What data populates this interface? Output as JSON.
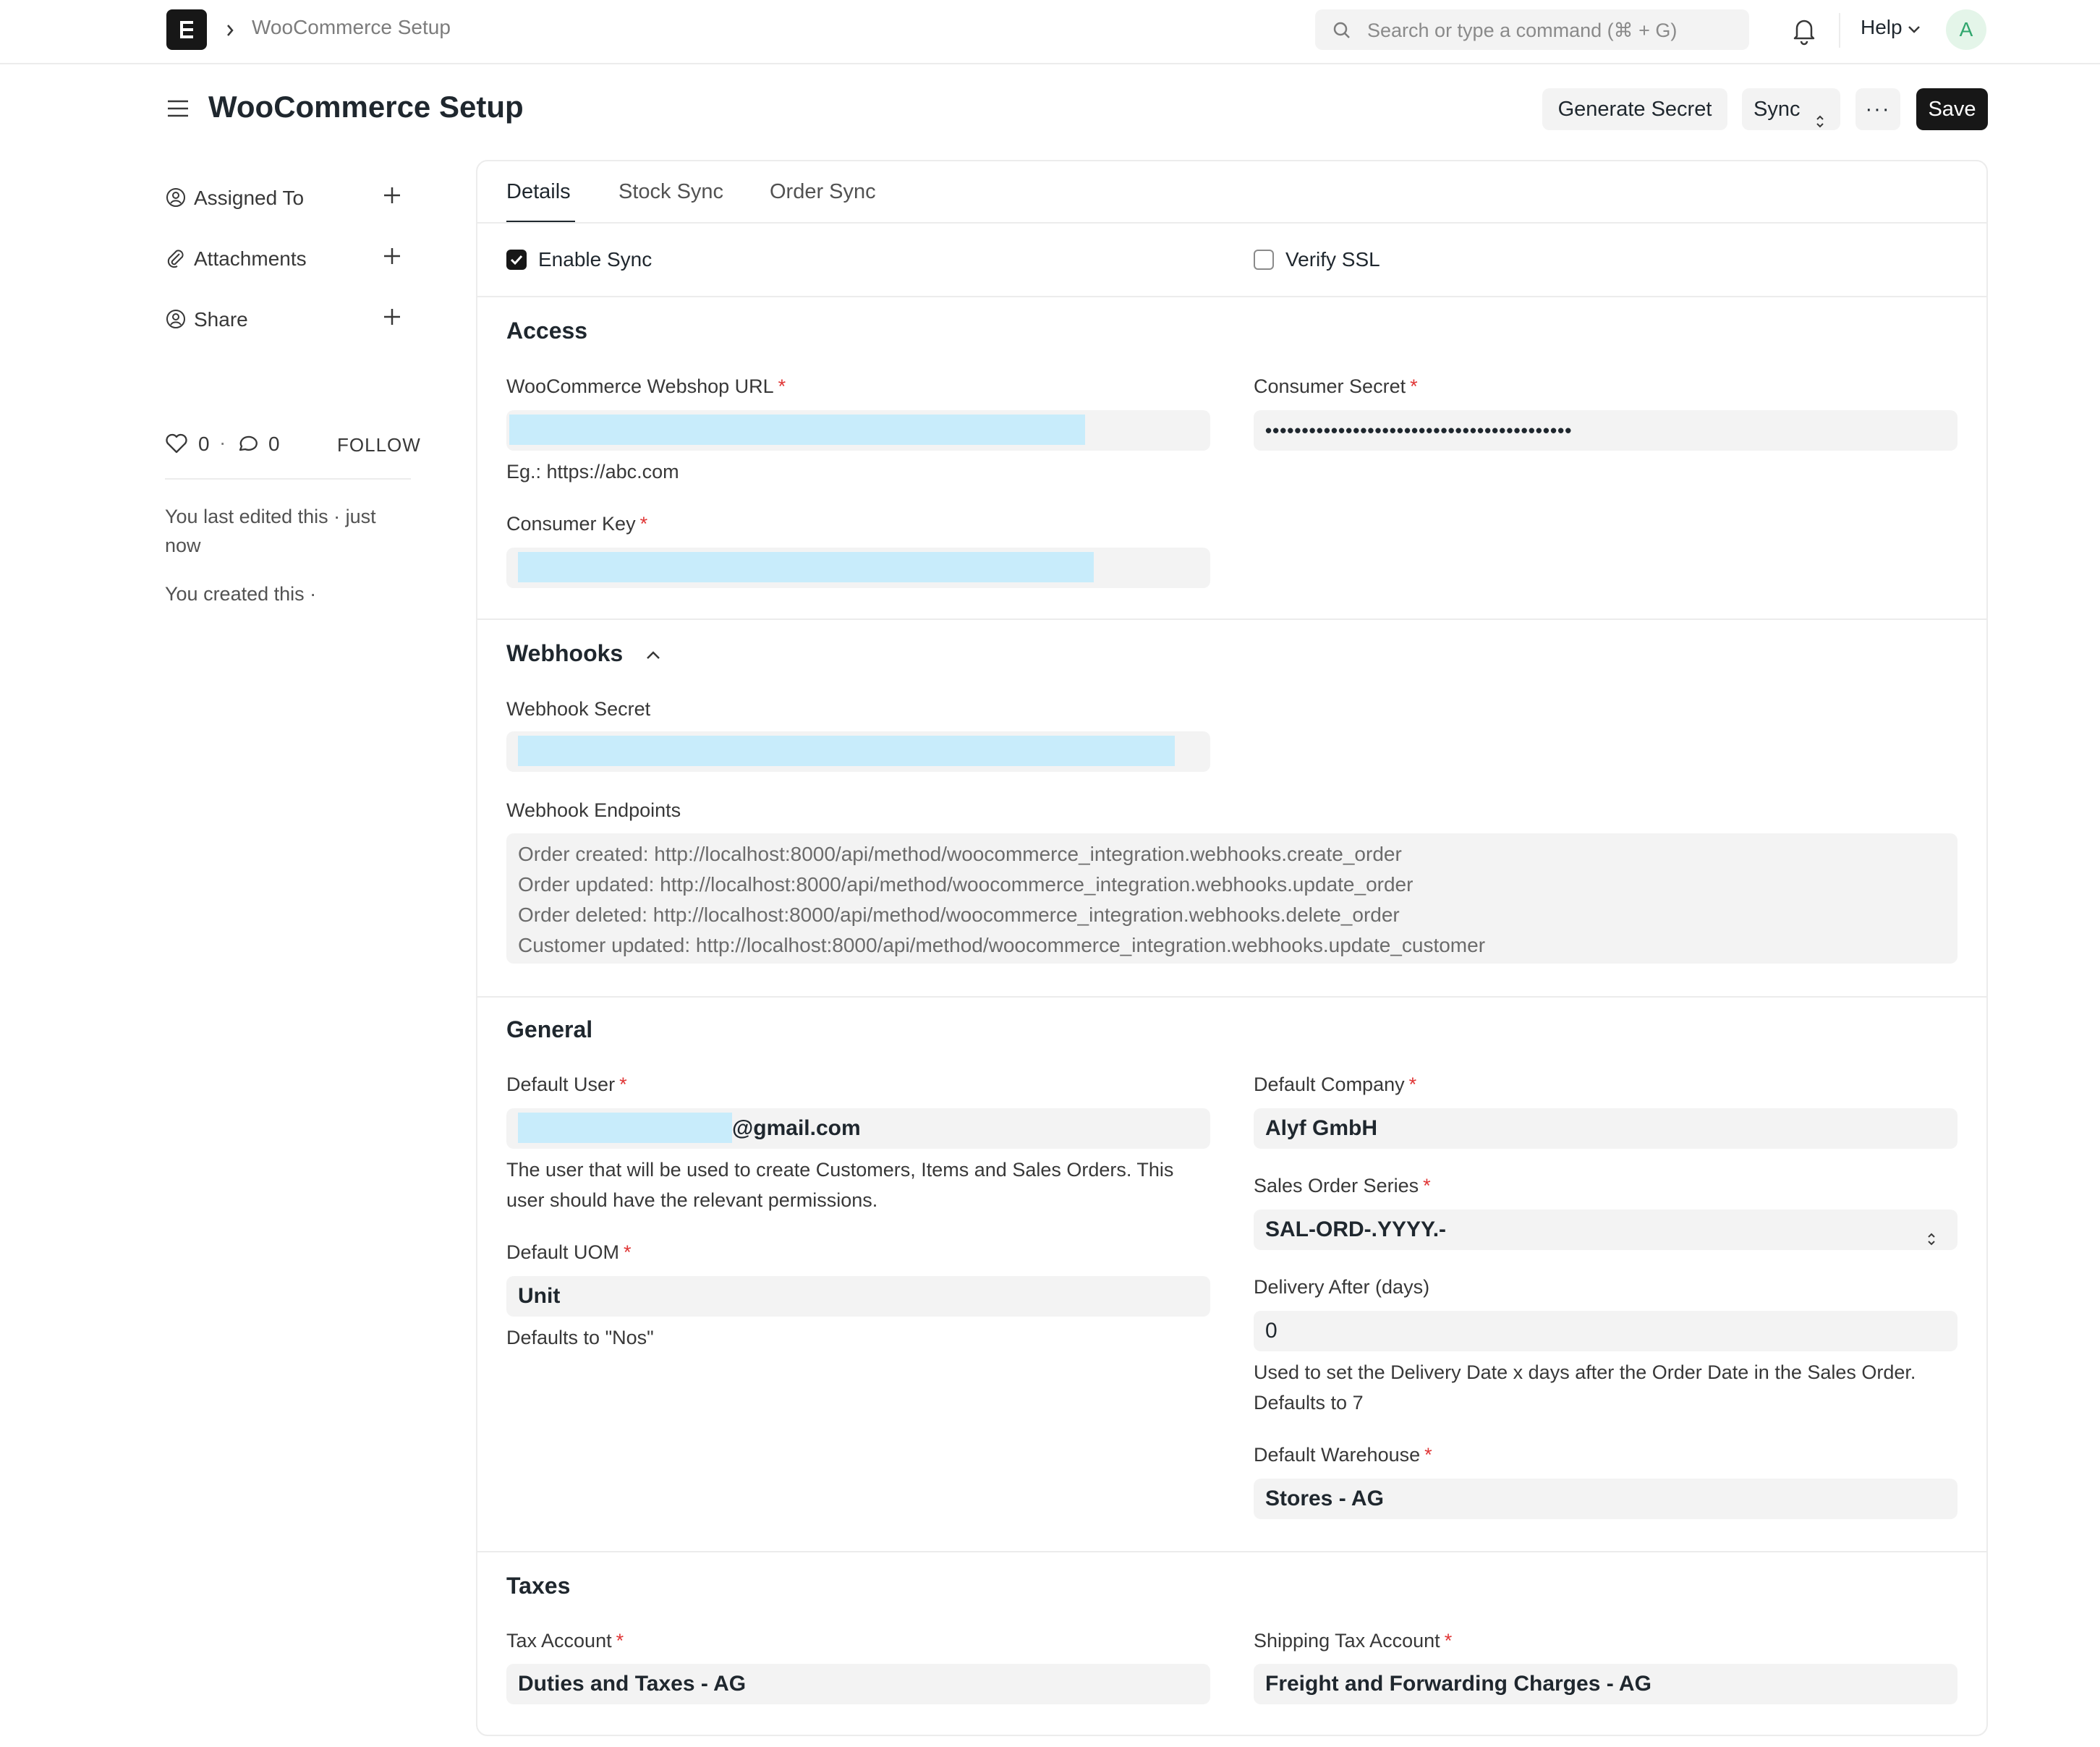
{
  "navbar": {
    "breadcrumb": "WooCommerce Setup",
    "search_placeholder": "Search or type a command (⌘ + G)",
    "help_label": "Help",
    "avatar_initial": "A"
  },
  "page": {
    "title": "WooCommerce Setup",
    "actions": {
      "generate_secret": "Generate Secret",
      "sync": "Sync",
      "more": "···",
      "save": "Save"
    }
  },
  "sidebar": {
    "items": [
      {
        "label": "Assigned To",
        "icon": "assign-icon"
      },
      {
        "label": "Attachments",
        "icon": "paperclip-icon"
      },
      {
        "label": "Share",
        "icon": "share-icon"
      }
    ],
    "likes": "0",
    "comments": "0",
    "follow": "FOLLOW",
    "activity": [
      "You last edited this · just now",
      "You created this ·"
    ]
  },
  "tabs": [
    "Details",
    "Stock Sync",
    "Order Sync"
  ],
  "sync": {
    "enable_sync": {
      "label": "Enable Sync",
      "checked": true
    },
    "verify_ssl": {
      "label": "Verify SSL",
      "checked": false
    }
  },
  "access": {
    "title": "Access",
    "webshop_url_label": "WooCommerce Webshop URL",
    "webshop_url_hint": "Eg.: https://abc.com",
    "consumer_key_label": "Consumer Key",
    "consumer_secret_label": "Consumer Secret",
    "consumer_secret_value": "••••••••••••••••••••••••••••••••••••••••••"
  },
  "webhooks": {
    "title": "Webhooks",
    "secret_label": "Webhook Secret",
    "endpoints_label": "Webhook Endpoints",
    "endpoints": [
      "Order created: http://localhost:8000/api/method/woocommerce_integration.webhooks.create_order",
      "Order updated: http://localhost:8000/api/method/woocommerce_integration.webhooks.update_order",
      "Order deleted: http://localhost:8000/api/method/woocommerce_integration.webhooks.delete_order",
      "Customer updated: http://localhost:8000/api/method/woocommerce_integration.webhooks.update_customer"
    ]
  },
  "general": {
    "title": "General",
    "default_user_label": "Default User",
    "default_user_value": "@gmail.com",
    "default_user_desc": [
      "The user that will be used to create Customers, Items and Sales Orders. This",
      "user should have the relevant permissions."
    ],
    "default_uom_label": "Default UOM",
    "default_uom_value": "Unit",
    "default_uom_desc": "Defaults to \"Nos\"",
    "default_company_label": "Default Company",
    "default_company_value": "Alyf GmbH",
    "sales_order_series_label": "Sales Order Series",
    "sales_order_series_value": "SAL-ORD-.YYYY.-",
    "delivery_after_label": "Delivery After (days)",
    "delivery_after_value": "0",
    "delivery_after_desc": [
      "Used to set the Delivery Date x days after the Order Date in the Sales Order.",
      "Defaults to 7"
    ],
    "default_warehouse_label": "Default Warehouse",
    "default_warehouse_value": "Stores - AG"
  },
  "taxes": {
    "title": "Taxes",
    "tax_account_label": "Tax Account",
    "tax_account_value": "Duties and Taxes - AG",
    "shipping_tax_label": "Shipping Tax Account",
    "shipping_tax_value": "Freight and Forwarding Charges - AG"
  }
}
